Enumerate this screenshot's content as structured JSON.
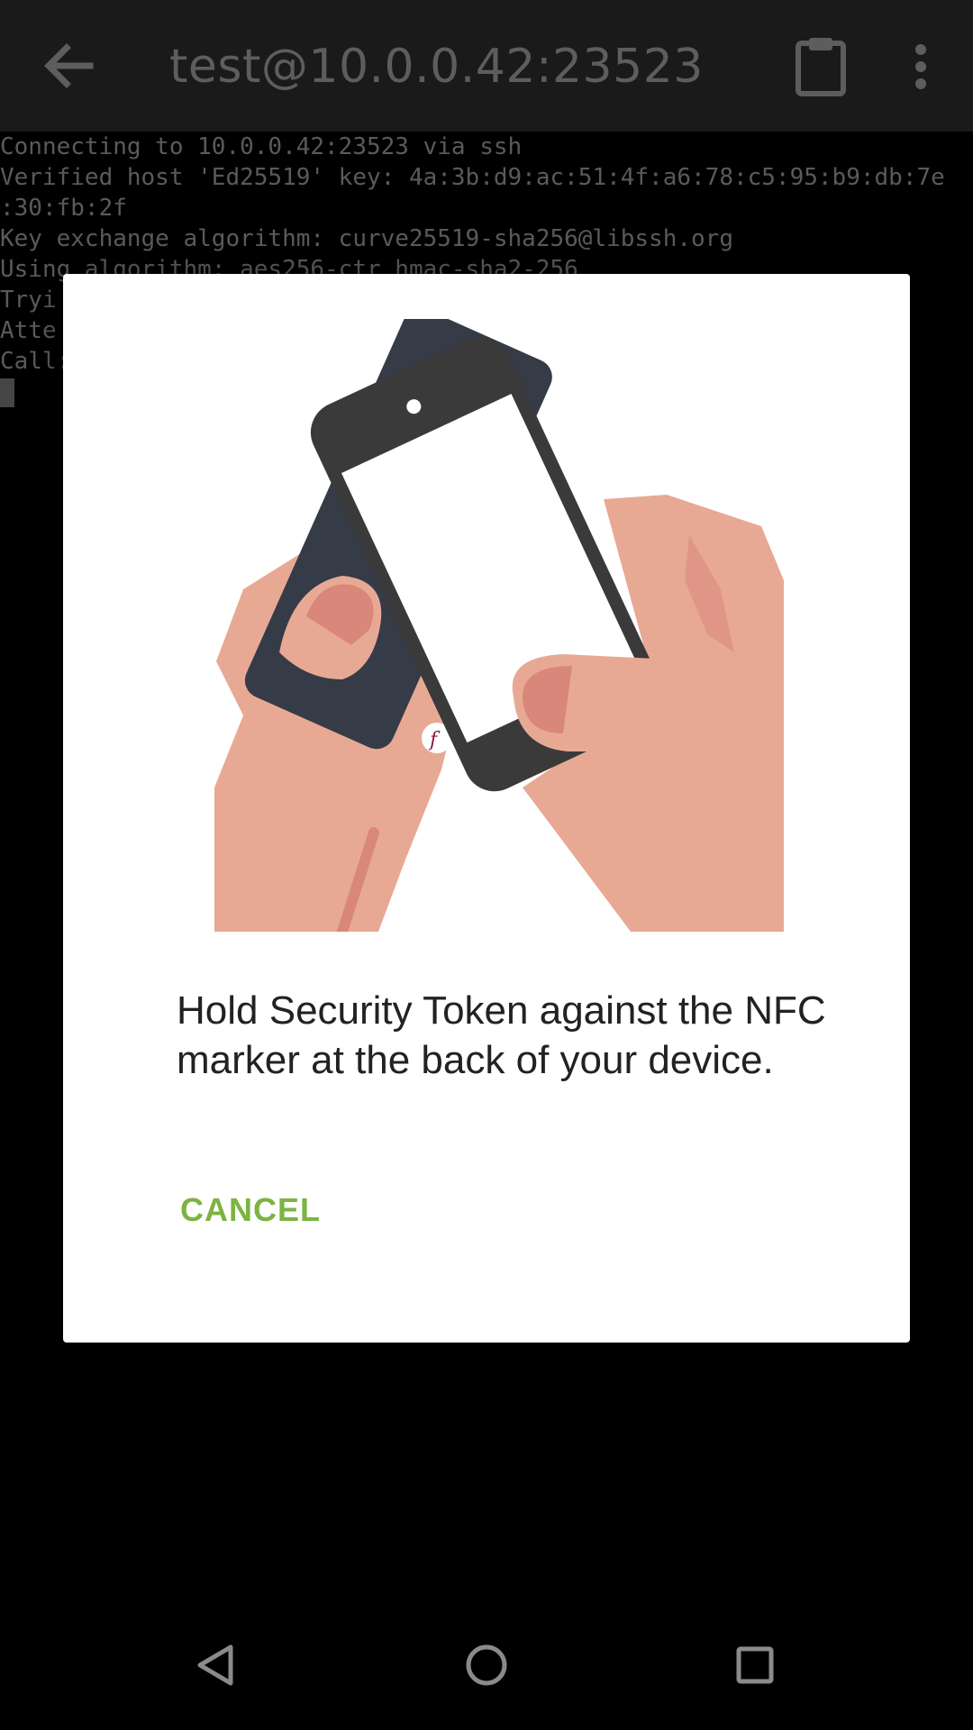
{
  "app_bar": {
    "title": "test@10.0.0.42:23523",
    "back_icon": "arrow-back-icon",
    "clipboard_icon": "clipboard-icon",
    "more_icon": "more-vert-icon"
  },
  "terminal": {
    "lines": [
      "Connecting to 10.0.0.42:23523 via ssh",
      "Verified host 'Ed25519' key: 4a:3b:d9:ac:51:4f:a6:78:c5:95:b9:db:7e",
      ":30:fb:2f",
      "Key exchange algorithm: curve25519-sha256@libssh.org",
      "Using algorithm: aes256-ctr hmac-sha2-256",
      "Tryi",
      "Atte",
      "Call:"
    ]
  },
  "dialog": {
    "illustration": "nfc-security-token-illustration",
    "message": "Hold Security Token against the NFC marker at the back of your device.",
    "cancel_label": "CANCEL"
  },
  "colors": {
    "accent": "#7cb342",
    "appbar_bg": "#1a1a1a",
    "skin": "#e8a994",
    "token": "#363b48"
  },
  "nav_bar": {
    "back_icon": "nav-back-icon",
    "home_icon": "nav-home-icon",
    "recents_icon": "nav-recents-icon"
  }
}
